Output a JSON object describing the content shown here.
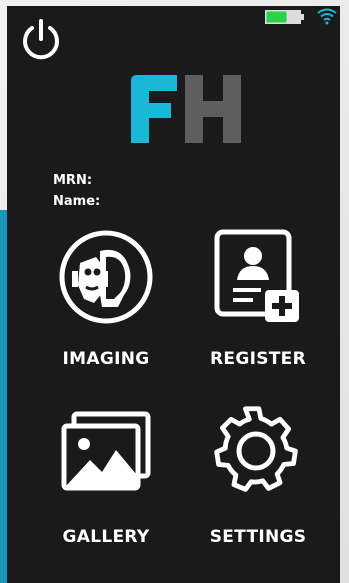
{
  "status": {
    "battery_icon": "battery-icon",
    "wifi_icon": "wifi-icon",
    "battery_color": "#2ad24a"
  },
  "power_icon": "power-icon",
  "logo": {
    "letter1": "F",
    "letter2": "H",
    "letter1_color": "#1ab8d8",
    "letter2_color": "#5e5e5e"
  },
  "patient": {
    "mrn_label": "MRN:",
    "name_label": "Name:"
  },
  "menu": [
    {
      "label": "IMAGING",
      "icon": "face-scan-icon"
    },
    {
      "label": "REGISTER",
      "icon": "add-patient-icon"
    },
    {
      "label": "GALLERY",
      "icon": "gallery-icon"
    },
    {
      "label": "SETTINGS",
      "icon": "gear-icon"
    }
  ]
}
